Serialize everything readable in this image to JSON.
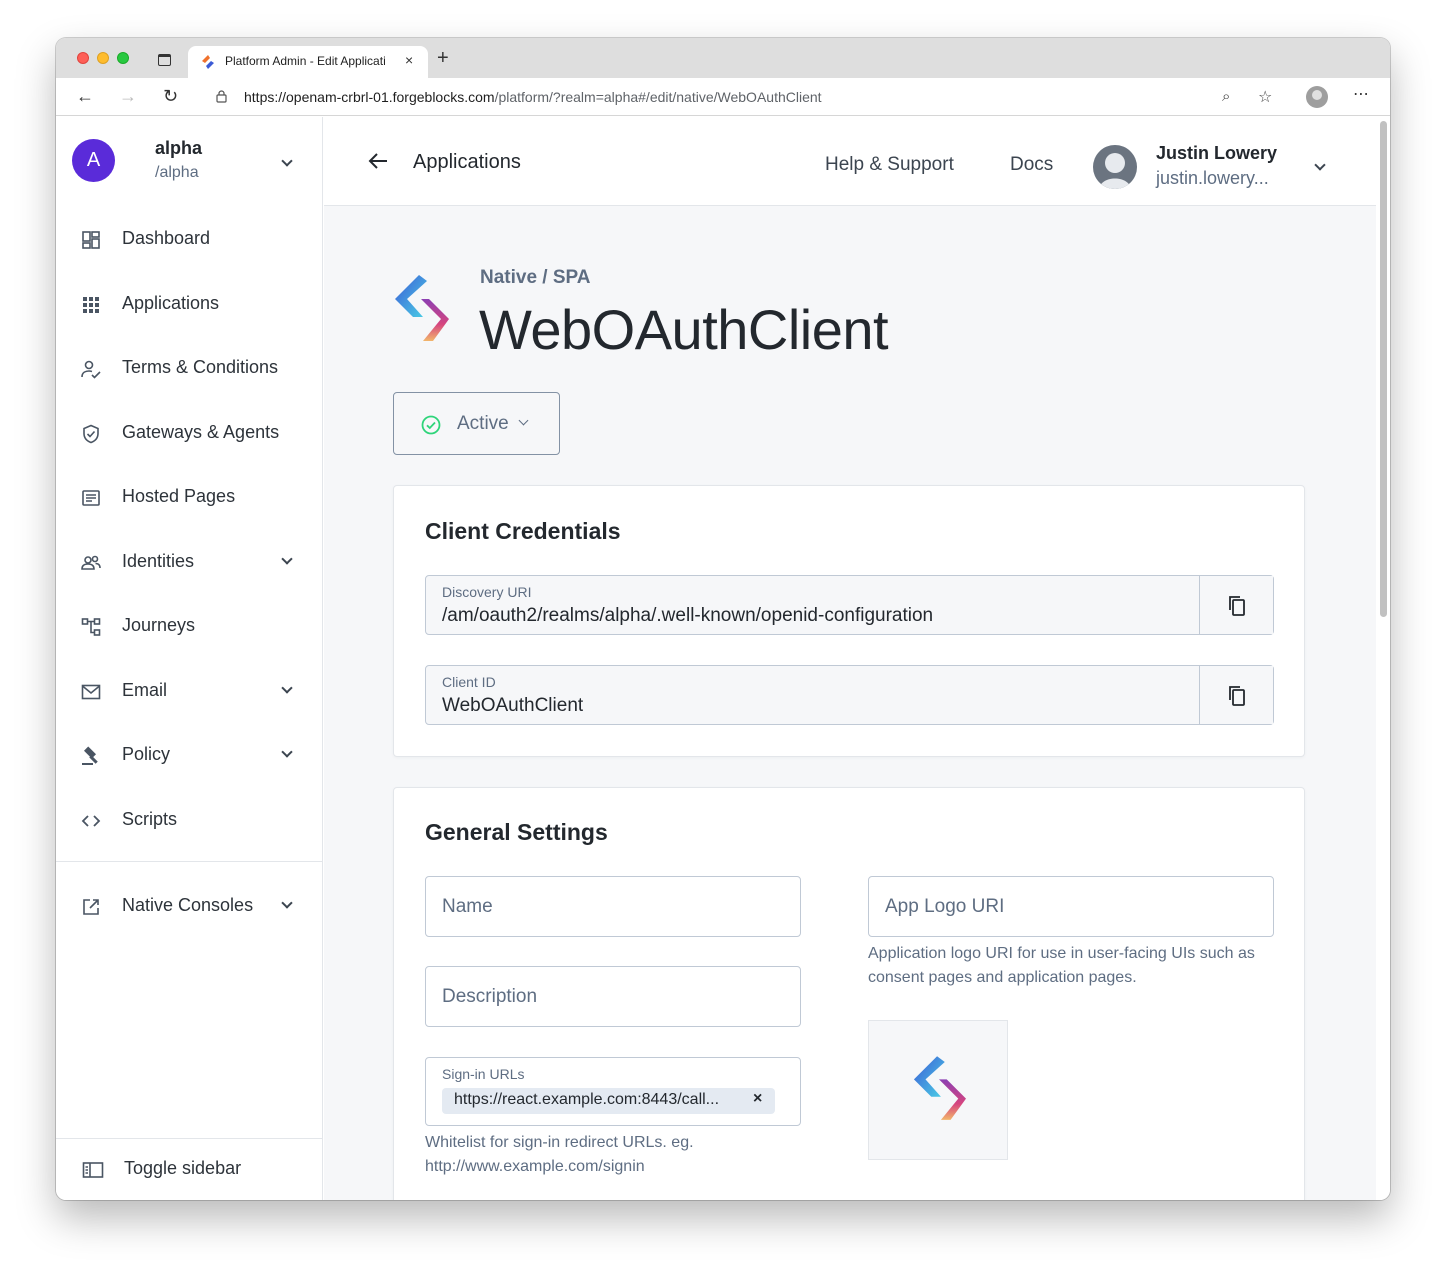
{
  "browser": {
    "tab_title": "Platform Admin - Edit Applicati",
    "url_host": "https://openam-crbrl-01.forgeblocks.com",
    "url_path": "/platform/?realm=alpha#/edit/native/WebOAuthClient",
    "new_tab_label": "+",
    "close_tab_label": "×"
  },
  "realm": {
    "avatar_letter": "A",
    "name": "alpha",
    "path": "/alpha"
  },
  "sidebar": {
    "items": [
      {
        "label": "Dashboard",
        "icon": "dashboard-icon"
      },
      {
        "label": "Applications",
        "icon": "apps-grid-icon"
      },
      {
        "label": "Terms & Conditions",
        "icon": "person-check-icon"
      },
      {
        "label": "Gateways & Agents",
        "icon": "shield-check-icon"
      },
      {
        "label": "Hosted Pages",
        "icon": "page-icon"
      },
      {
        "label": "Identities",
        "icon": "people-icon",
        "expandable": true
      },
      {
        "label": "Journeys",
        "icon": "journey-tree-icon"
      },
      {
        "label": "Email",
        "icon": "mail-icon",
        "expandable": true
      },
      {
        "label": "Policy",
        "icon": "gavel-icon",
        "expandable": true
      },
      {
        "label": "Scripts",
        "icon": "code-icon"
      }
    ],
    "native_consoles": "Native Consoles",
    "toggle": "Toggle sidebar"
  },
  "header": {
    "back_title": "Applications",
    "help_link": "Help & Support",
    "docs_link": "Docs",
    "user_name": "Justin Lowery",
    "user_email": "justin.lowery..."
  },
  "app": {
    "type": "Native / SPA",
    "name": "WebOAuthClient",
    "status": "Active"
  },
  "credentials": {
    "title": "Client Credentials",
    "discovery_label": "Discovery URI",
    "discovery_value": "/am/oauth2/realms/alpha/.well-known/openid-configuration",
    "client_id_label": "Client ID",
    "client_id_value": "WebOAuthClient"
  },
  "general": {
    "title": "General Settings",
    "name_placeholder": "Name",
    "description_placeholder": "Description",
    "signin_label": "Sign-in URLs",
    "signin_tag": "https://react.example.com:8443/call...",
    "signin_help": "Whitelist for sign-in redirect URLs. eg. http://www.example.com/signin",
    "logo_placeholder": "App Logo URI",
    "logo_help": "Application logo URI for use in user-facing UIs such as consent pages and application pages."
  },
  "colors": {
    "realm_avatar": "#5a2bd9",
    "active_check": "#2ed47a",
    "text_primary": "#23282e",
    "text_muted": "#5e6d82"
  }
}
